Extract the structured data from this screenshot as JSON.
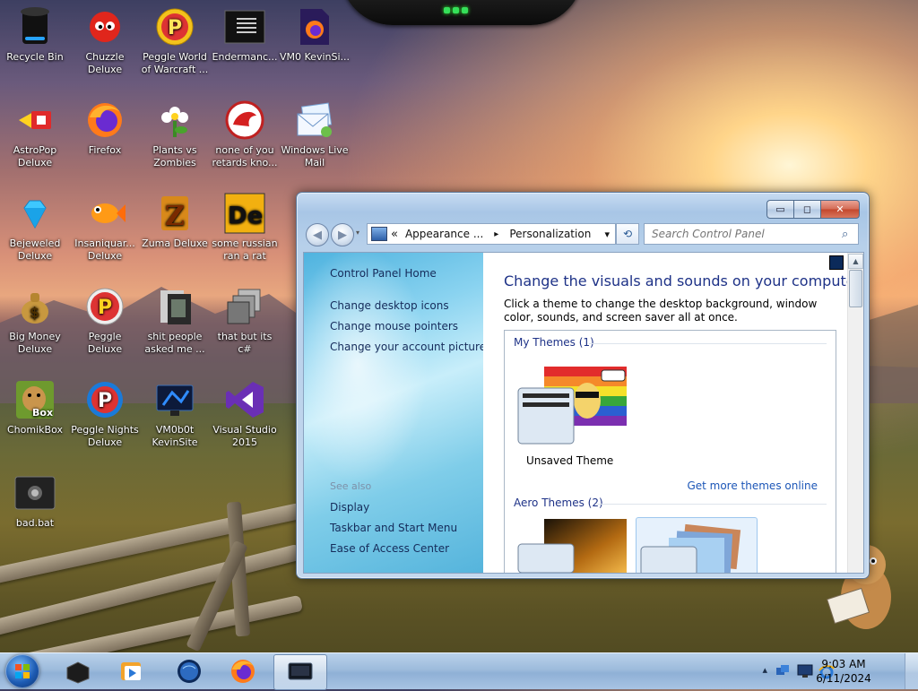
{
  "desktop": {
    "icons": [
      {
        "label": "Recycle Bin"
      },
      {
        "label": "Chuzzle Deluxe"
      },
      {
        "label": "Peggle World of Warcraft ..."
      },
      {
        "label": "Endermanc..."
      },
      {
        "label": "VM0 KevinSi..."
      },
      {
        "label": "AstroPop Deluxe"
      },
      {
        "label": "Firefox"
      },
      {
        "label": "Plants vs Zombies"
      },
      {
        "label": "none of you retards kno..."
      },
      {
        "label": "Windows Live Mail"
      },
      {
        "label": "Bejeweled Deluxe"
      },
      {
        "label": "Insaniquar... Deluxe"
      },
      {
        "label": "Zuma Deluxe"
      },
      {
        "label": "some russian ran a rat"
      },
      {
        "label": "Big Money Deluxe"
      },
      {
        "label": "Peggle Deluxe"
      },
      {
        "label": "shit people asked me ..."
      },
      {
        "label": "that but its c#"
      },
      {
        "label": "ChomikBox"
      },
      {
        "label": "Peggle Nights Deluxe"
      },
      {
        "label": "VM0b0t KevinSite"
      },
      {
        "label": "Visual Studio 2015"
      },
      {
        "label": "bad.bat"
      }
    ]
  },
  "window": {
    "title_controls": {
      "minimize": "▭",
      "maximize": "◻",
      "close": "✕"
    },
    "address": {
      "overflow": "«",
      "crumbs": [
        "Appearance ...",
        "Personalization"
      ],
      "separator": "▸",
      "dropdown": "▾"
    },
    "refresh_glyph": "⟲",
    "search": {
      "placeholder": "Search Control Panel",
      "value": ""
    },
    "left_pane": {
      "home_link": "Control Panel Home",
      "links": [
        "Change desktop icons",
        "Change mouse pointers",
        "Change your account picture"
      ],
      "see_also_label": "See also",
      "see_also_links": [
        "Display",
        "Taskbar and Start Menu",
        "Ease of Access Center"
      ]
    },
    "main": {
      "heading": "Change the visuals and sounds on your computer",
      "description": "Click a theme to change the desktop background, window color, sounds, and screen saver all at once.",
      "my_themes_label": "My Themes (1)",
      "unsaved_theme_label": "Unsaved Theme",
      "get_more_link": "Get more themes online",
      "aero_themes_label": "Aero Themes (2)"
    }
  },
  "taskbar": {
    "clock_time": "9:03 AM",
    "clock_date": "6/11/2024",
    "tray_expand": "▴"
  },
  "colors": {
    "link": "#152b5a",
    "heading": "#1e3287",
    "taskbar": "#9dbbdc"
  }
}
